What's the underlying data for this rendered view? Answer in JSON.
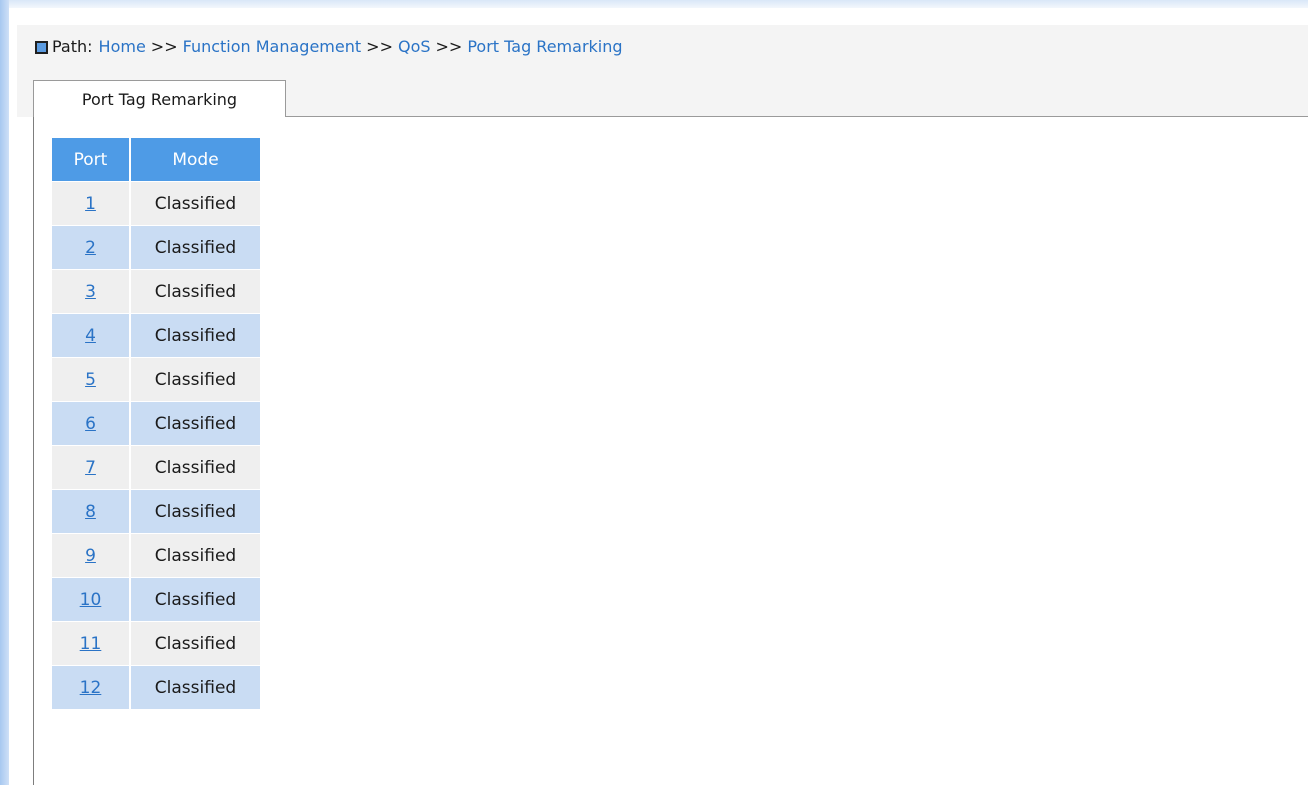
{
  "breadcrumb": {
    "label": "Path:",
    "items": [
      "Home",
      "Function Management",
      "QoS",
      "Port Tag Remarking"
    ],
    "separator": ">>"
  },
  "tab": {
    "label": "Port Tag Remarking"
  },
  "table": {
    "headers": [
      "Port",
      "Mode"
    ],
    "rows": [
      {
        "port": "1",
        "mode": "Classified"
      },
      {
        "port": "2",
        "mode": "Classified"
      },
      {
        "port": "3",
        "mode": "Classified"
      },
      {
        "port": "4",
        "mode": "Classified"
      },
      {
        "port": "5",
        "mode": "Classified"
      },
      {
        "port": "6",
        "mode": "Classified"
      },
      {
        "port": "7",
        "mode": "Classified"
      },
      {
        "port": "8",
        "mode": "Classified"
      },
      {
        "port": "9",
        "mode": "Classified"
      },
      {
        "port": "10",
        "mode": "Classified"
      },
      {
        "port": "11",
        "mode": "Classified"
      },
      {
        "port": "12",
        "mode": "Classified"
      }
    ]
  },
  "colors": {
    "accent": "#4e9be6",
    "link": "#2a73c6",
    "row_alt": "#c9dcf3",
    "row_base": "#efefef"
  }
}
